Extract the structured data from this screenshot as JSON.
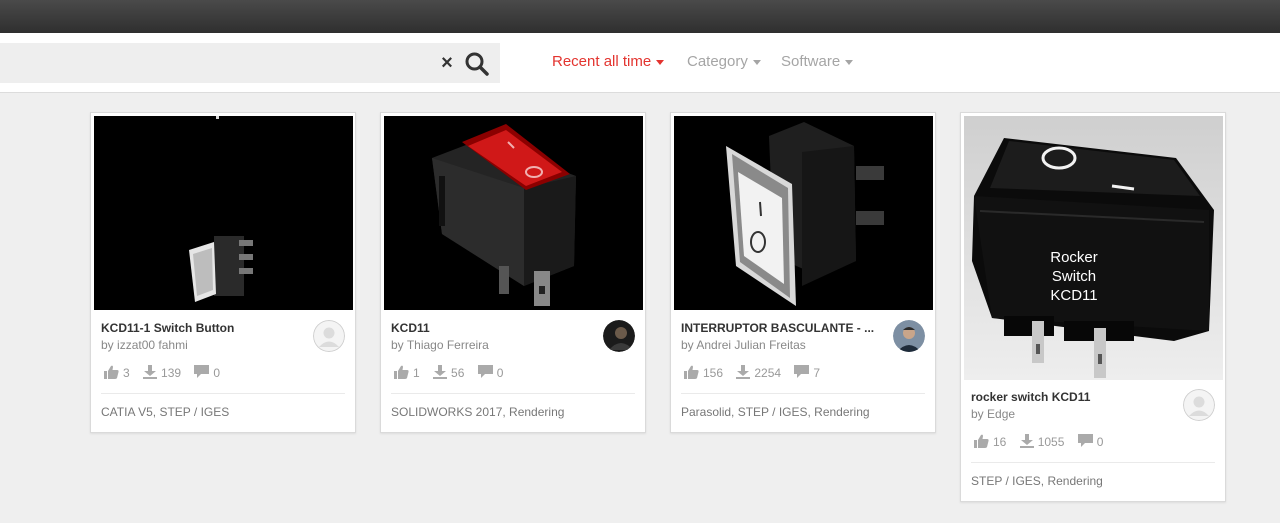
{
  "search": {
    "value": "",
    "placeholder": ""
  },
  "filters": {
    "sort_label": "Recent all time",
    "category_label": "Category",
    "software_label": "Software",
    "active_color": "#e3342f",
    "inactive_color": "#a5a5a5"
  },
  "cards": [
    {
      "title": "KCD11-1 Switch Button",
      "by": "by",
      "author": "izzat00 fahmi",
      "likes": "3",
      "downloads": "139",
      "comments": "0",
      "tags": "CATIA V5, STEP / IGES",
      "avatar": "default-avatar"
    },
    {
      "title": "KCD11",
      "by": "by",
      "author": "Thiago Ferreira",
      "likes": "1",
      "downloads": "56",
      "comments": "0",
      "tags": "SOLIDWORKS 2017, Rendering",
      "avatar": "photo-avatar"
    },
    {
      "title": "INTERRUPTOR BASCULANTE - ...",
      "by": "by",
      "author": "Andrei Julian Freitas",
      "likes": "156",
      "downloads": "2254",
      "comments": "7",
      "tags": "Parasolid, STEP / IGES, Rendering",
      "avatar": "photo-avatar"
    },
    {
      "title": "rocker switch KCD11",
      "by": "by",
      "author": "Edge",
      "likes": "16",
      "downloads": "1055",
      "comments": "0",
      "tags": "STEP / IGES, Rendering",
      "avatar": "default-avatar",
      "thumbnail_text": [
        "Rocker",
        "Switch",
        "KCD11"
      ]
    }
  ],
  "icons": {
    "clear": "close-icon",
    "search": "search-icon",
    "likes": "thumbs-up-icon",
    "downloads": "download-icon",
    "comments": "comment-icon"
  },
  "clear_glyph": "×"
}
